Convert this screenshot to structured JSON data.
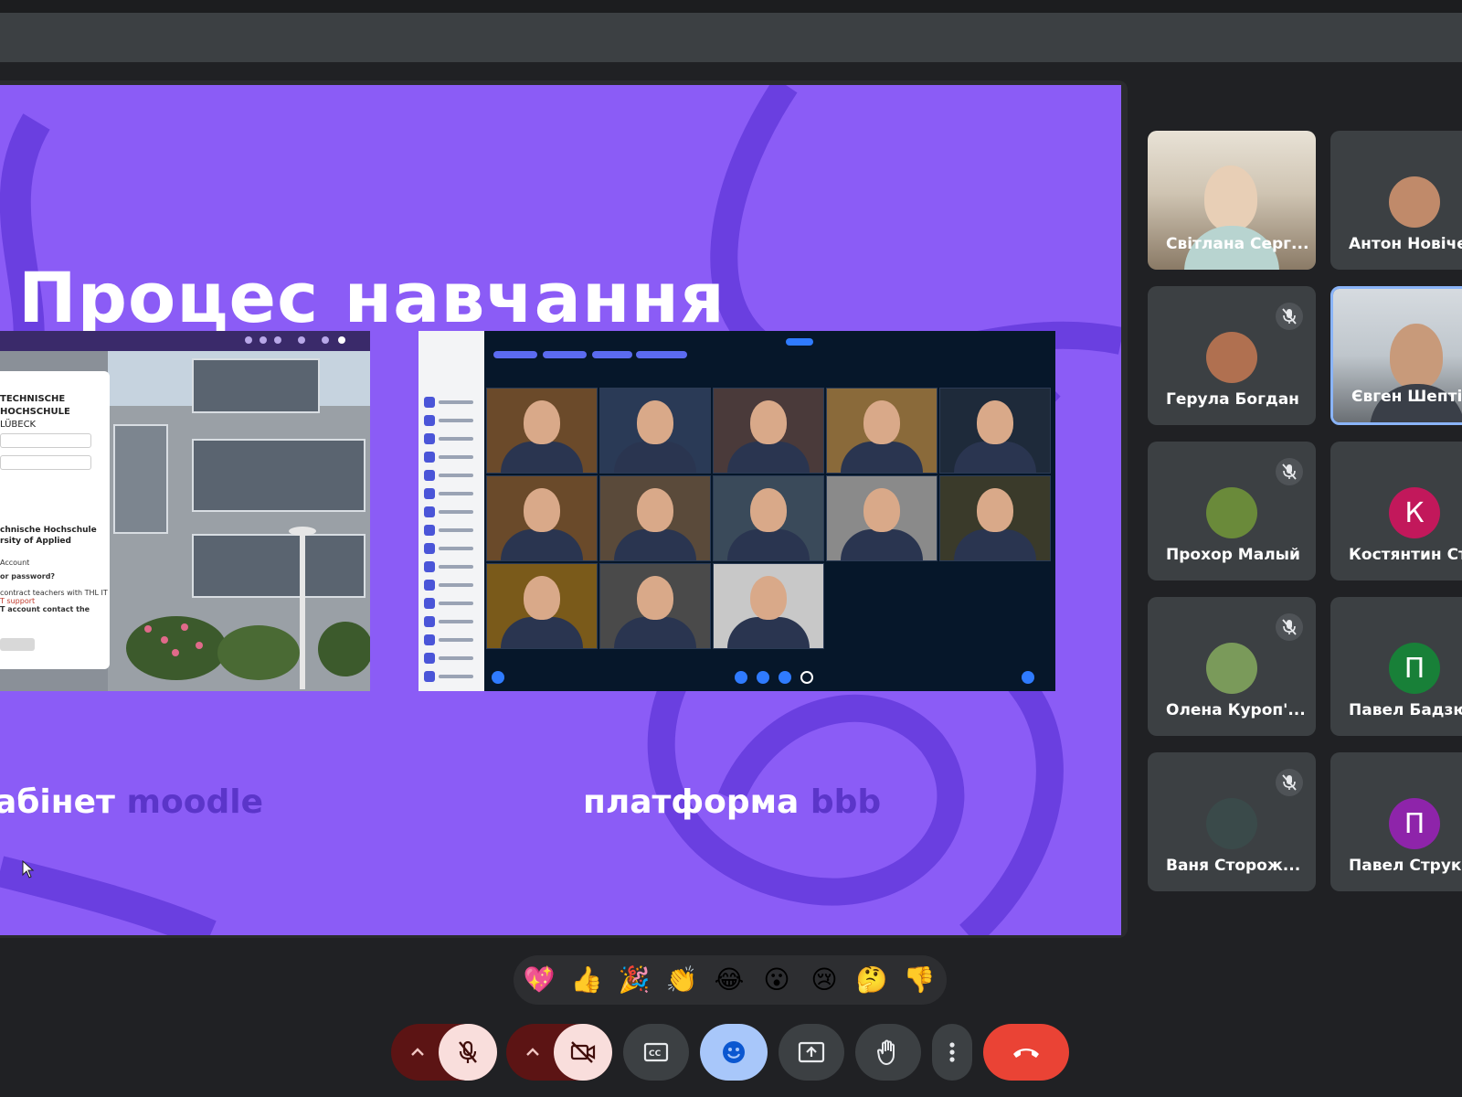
{
  "slide": {
    "title": "Процес навчання",
    "caption_left": "абінет",
    "caption_left_accent": "moodle",
    "caption_right": "платформа",
    "caption_right_accent": "bbb"
  },
  "moodle_card": {
    "line1": "TECHNISCHE",
    "line2": "HOCHSCHULE",
    "line3": "LÜBECK",
    "line4": "chnische Hochschule",
    "line5": "rsity of Applied",
    "line6": "Account",
    "line7": "or password?",
    "line8": "contract teachers with THL IT",
    "line9": "T support",
    "line10": "T account contact the"
  },
  "participants": [
    {
      "name": "Світлана Серг...",
      "type": "video",
      "muted": false
    },
    {
      "name": "Антон Новіче...",
      "type": "avatar-photo",
      "muted": false
    },
    {
      "name": "Герула Богдан",
      "type": "avatar-photo",
      "muted": true
    },
    {
      "name": "Євген Шептій",
      "type": "video",
      "muted": false,
      "active": true
    },
    {
      "name": "Прохор Малый",
      "type": "avatar-photo",
      "muted": true
    },
    {
      "name": "Костянтин Ст...",
      "type": "letter",
      "letter": "К",
      "color": "#c2185b",
      "muted": false
    },
    {
      "name": "Олена Куроп'...",
      "type": "avatar-photo",
      "muted": true
    },
    {
      "name": "Павел Бадзюх...",
      "type": "letter",
      "letter": "П",
      "color": "#188038",
      "muted": false
    },
    {
      "name": "Ваня Сторож...",
      "type": "avatar-photo",
      "muted": true
    },
    {
      "name": "Павел Струко...",
      "type": "letter",
      "letter": "П",
      "color": "#8e24aa",
      "muted": false
    }
  ],
  "reactions": [
    "💖",
    "👍",
    "🎉",
    "👏",
    "😂",
    "😮",
    "😢",
    "🤔",
    "👎"
  ],
  "controls": {
    "mic_options_icon": "chevron-up-icon",
    "mic_icon": "mic-off-icon",
    "cam_options_icon": "chevron-up-icon",
    "cam_icon": "videocam-off-icon",
    "captions_icon": "closed-caption-icon",
    "reactions_icon": "emoji-icon",
    "present_icon": "present-screen-icon",
    "hand_icon": "raise-hand-icon",
    "more_icon": "more-vert-icon",
    "hangup_icon": "call-end-icon"
  },
  "colors": {
    "slide_bg": "#8b5cf6",
    "slide_accent": "#5b35c9",
    "meet_bg": "#202124",
    "tile_bg": "#3c4043",
    "hangup": "#ea4335"
  }
}
